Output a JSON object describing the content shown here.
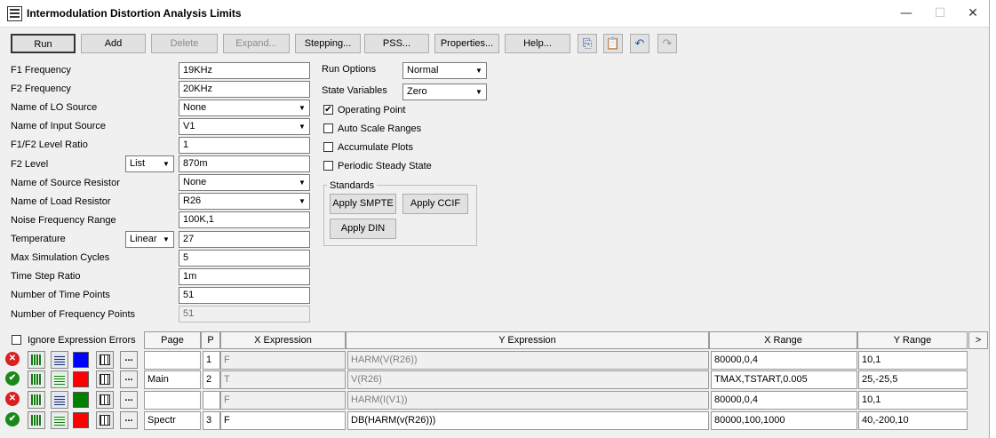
{
  "window": {
    "title": "Intermodulation Distortion Analysis Limits"
  },
  "toolbar": {
    "buttons": [
      "Run",
      "Add",
      "Delete",
      "Expand...",
      "Stepping...",
      "PSS...",
      "Properties...",
      "Help..."
    ]
  },
  "params": [
    {
      "label": "F1 Frequency",
      "value": "19KHz"
    },
    {
      "label": "F2 Frequency",
      "value": "20KHz"
    },
    {
      "label": "Name of LO Source",
      "value": "None"
    },
    {
      "label": "Name of Input Source",
      "value": "V1"
    },
    {
      "label": "F1/F2 Level Ratio",
      "value": "1"
    },
    {
      "label": "F2 Level",
      "value": "870m",
      "mode": "List"
    },
    {
      "label": "Name of Source Resistor",
      "value": "None"
    },
    {
      "label": "Name of Load Resistor",
      "value": "R26"
    },
    {
      "label": "Noise Frequency Range",
      "value": "100K,1"
    },
    {
      "label": "Temperature",
      "value": "27",
      "mode": "Linear"
    },
    {
      "label": "Max Simulation Cycles",
      "value": "5"
    },
    {
      "label": "Time Step Ratio",
      "value": "1m"
    },
    {
      "label": "Number of Time Points",
      "value": "51"
    },
    {
      "label": "Number of Frequency Points",
      "value": "51"
    }
  ],
  "options": {
    "run_options_label": "Run Options",
    "run_options_value": "Normal",
    "state_vars_label": "State Variables",
    "state_vars_value": "Zero",
    "checkboxes": [
      {
        "label": "Operating Point",
        "checked": true
      },
      {
        "label": "Auto Scale Ranges",
        "checked": false
      },
      {
        "label": "Accumulate Plots",
        "checked": false
      },
      {
        "label": "Periodic Steady State",
        "checked": false
      }
    ],
    "standards_title": "Standards",
    "smpte": "Apply SMPTE",
    "ccif": "Apply CCIF",
    "din": "Apply DIN"
  },
  "table": {
    "ignore_label": "Ignore Expression Errors",
    "headers": {
      "page": "Page",
      "p": "P",
      "x": "X Expression",
      "y": "Y Expression",
      "xr": "X Range",
      "yr": "Y Range",
      "more": ">"
    },
    "rows": [
      {
        "page": "",
        "p": "1",
        "x": "F",
        "y": "HARM(V(R26))",
        "xr": "80000,0,4",
        "yr": "10,1",
        "enabled": false,
        "color": "#0000ff"
      },
      {
        "page": "Main",
        "p": "2",
        "x": "T",
        "y": "V(R26)",
        "xr": "TMAX,TSTART,0.005",
        "yr": "25,-25,5",
        "enabled": true,
        "color": "#ff0000"
      },
      {
        "page": "",
        "p": "",
        "x": "F",
        "y": "HARM(I(V1))",
        "xr": "80000,0,4",
        "yr": "10,1",
        "enabled": false,
        "color": "#008000"
      },
      {
        "page": "Spectr",
        "p": "3",
        "x": "F",
        "y": "DB(HARM(v(R26)))",
        "xr": "80000,100,1000",
        "yr": "40,-200,10",
        "enabled": true,
        "color": "#ff0000"
      }
    ],
    "dots": "..."
  }
}
